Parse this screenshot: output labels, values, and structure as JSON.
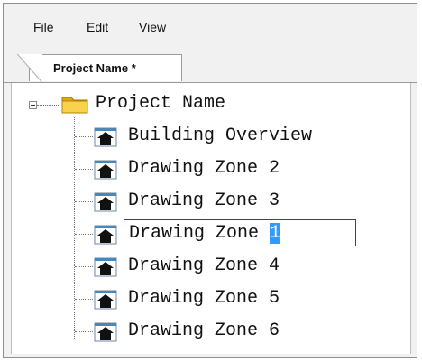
{
  "menu": {
    "file": "File",
    "edit": "Edit",
    "view": "View"
  },
  "tab": {
    "label": "Project Name *"
  },
  "tree": {
    "root": {
      "label": "Project Name",
      "icon": "folder-icon"
    },
    "items": [
      {
        "label": "Building Overview",
        "icon": "building-icon"
      },
      {
        "label": "Drawing Zone 2",
        "icon": "building-icon"
      },
      {
        "label": "Drawing Zone 3",
        "icon": "building-icon"
      },
      {
        "label_prefix": "Drawing Zone ",
        "label_selected": "1",
        "editing": true,
        "icon": "building-icon"
      },
      {
        "label": "Drawing Zone 4",
        "icon": "building-icon"
      },
      {
        "label": "Drawing Zone 5",
        "icon": "building-icon"
      },
      {
        "label": "Drawing Zone 6",
        "icon": "building-icon"
      }
    ]
  },
  "colors": {
    "selection": "#3399ff",
    "folder": "#f2c230"
  }
}
